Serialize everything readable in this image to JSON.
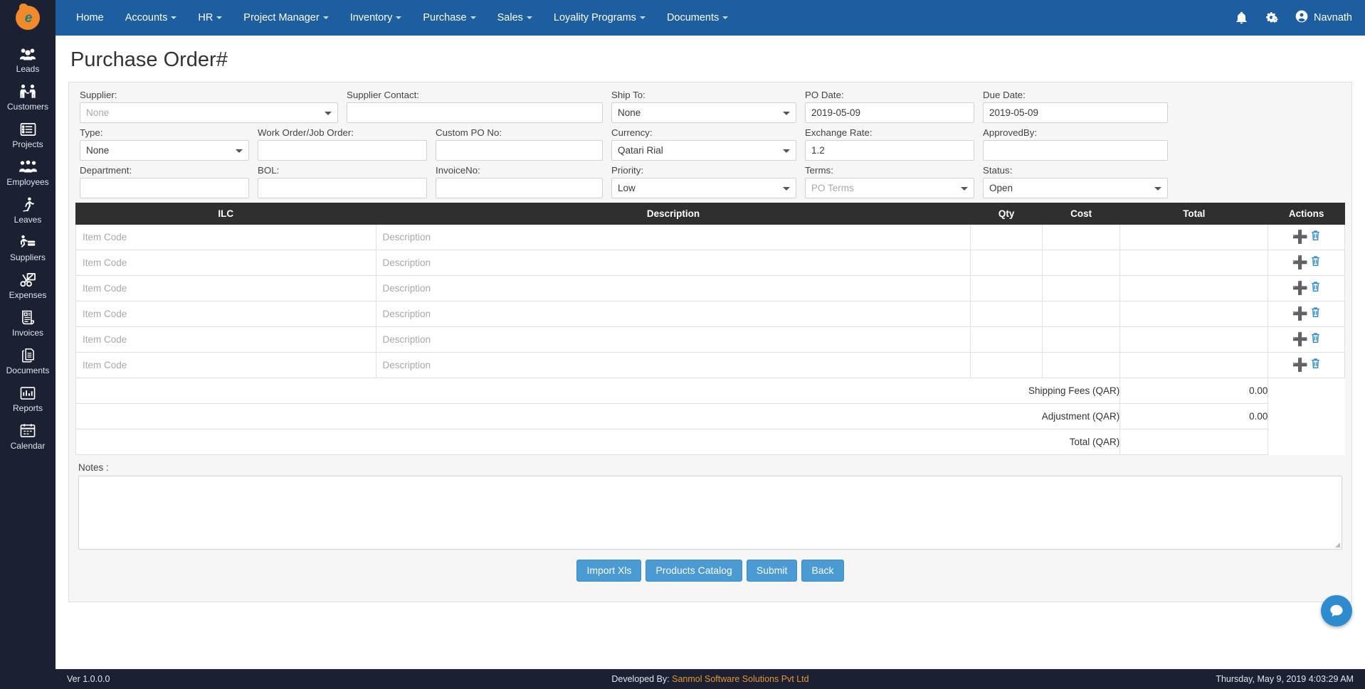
{
  "navbar": {
    "brand_icon": "brand-logo-icon",
    "menu": [
      {
        "label": "Home",
        "caret": false
      },
      {
        "label": "Accounts",
        "caret": true
      },
      {
        "label": "HR",
        "caret": true
      },
      {
        "label": "Project Manager",
        "caret": true
      },
      {
        "label": "Inventory",
        "caret": true
      },
      {
        "label": "Purchase",
        "caret": true
      },
      {
        "label": "Sales",
        "caret": true
      },
      {
        "label": "Loyality Programs",
        "caret": true
      },
      {
        "label": "Documents",
        "caret": true
      }
    ],
    "bell_icon": "bell-icon",
    "gear_icon": "gears-icon",
    "user_icon": "user-circle-icon",
    "user_name": "Navnath"
  },
  "sidebar": {
    "items": [
      {
        "label": "Leads",
        "icon": "leads-icon",
        "glyph": "⚇"
      },
      {
        "label": "Customers",
        "icon": "customers-icon",
        "glyph": "♟"
      },
      {
        "label": "Projects",
        "icon": "projects-icon",
        "glyph": "▤"
      },
      {
        "label": "Employees",
        "icon": "employees-icon",
        "glyph": "♟"
      },
      {
        "label": "Leaves",
        "icon": "leaves-icon",
        "glyph": "↯"
      },
      {
        "label": "Suppliers",
        "icon": "suppliers-icon",
        "glyph": "⛏"
      },
      {
        "label": "Expenses",
        "icon": "expenses-icon",
        "glyph": "✂"
      },
      {
        "label": "Invoices",
        "icon": "invoices-icon",
        "glyph": "▤"
      },
      {
        "label": "Documents",
        "icon": "documents-icon",
        "glyph": "⎘"
      },
      {
        "label": "Reports",
        "icon": "reports-icon",
        "glyph": "▦"
      },
      {
        "label": "Calendar",
        "icon": "calendar-icon",
        "glyph": "Ὄ5"
      }
    ]
  },
  "page": {
    "title": "Purchase Order#"
  },
  "form": {
    "supplier": {
      "label": "Supplier:",
      "value": "None",
      "is_placeholder": true
    },
    "supplier_contact": {
      "label": "Supplier Contact:",
      "value": ""
    },
    "ship_to": {
      "label": "Ship To:",
      "value": "None",
      "is_placeholder": false
    },
    "po_date": {
      "label": "PO Date:",
      "value": "2019-05-09"
    },
    "due_date": {
      "label": "Due Date:",
      "value": "2019-05-09"
    },
    "type": {
      "label": "Type:",
      "value": "None",
      "is_placeholder": false
    },
    "work_order": {
      "label": "Work Order/Job Order:",
      "value": ""
    },
    "custom_po_no": {
      "label": "Custom PO No:",
      "value": ""
    },
    "currency": {
      "label": "Currency:",
      "value": "Qatari Rial"
    },
    "exchange_rate": {
      "label": "Exchange Rate:",
      "value": "1.2"
    },
    "approved_by": {
      "label": "ApprovedBy:",
      "value": ""
    },
    "department": {
      "label": "Department:",
      "value": ""
    },
    "bol": {
      "label": "BOL:",
      "value": ""
    },
    "invoice_no": {
      "label": "InvoiceNo:",
      "value": ""
    },
    "priority": {
      "label": "Priority:",
      "value": "Low"
    },
    "terms": {
      "label": "Terms:",
      "value": "PO Terms",
      "is_placeholder": true
    },
    "status": {
      "label": "Status:",
      "value": "Open"
    }
  },
  "items_table": {
    "columns": [
      "ILC",
      "Description",
      "Qty",
      "Cost",
      "Total",
      "Actions"
    ],
    "row_placeholders": {
      "ilc": "Item Code",
      "description": "Description",
      "qty": "",
      "cost": "",
      "total": ""
    },
    "row_count": 6,
    "action_icons": {
      "add": "plus-icon",
      "delete": "trash-icon"
    },
    "summary": [
      {
        "label": "Shipping Fees (QAR)",
        "value": "0.00"
      },
      {
        "label": "Adjustment (QAR)",
        "value": "0.00"
      },
      {
        "label": "Total (QAR)",
        "value": ""
      }
    ]
  },
  "notes": {
    "label": "Notes :",
    "value": ""
  },
  "buttons": [
    {
      "label": "Import Xls",
      "name": "import-xls-button"
    },
    {
      "label": "Products Catalog",
      "name": "products-catalog-button"
    },
    {
      "label": "Submit",
      "name": "submit-button"
    },
    {
      "label": "Back",
      "name": "back-button"
    }
  ],
  "chat": {
    "icon": "chat-bubble-icon"
  },
  "footer": {
    "version": "Ver 1.0.0.0",
    "developed_by_prefix": "Developed By: ",
    "developed_by": "Sanmol Software Solutions Pvt Ltd",
    "datetime": "Thursday, May 9, 2019 4:03:29 AM"
  },
  "colors": {
    "navbar": "#1c5ea0",
    "sidebar": "#1b2133",
    "table_header": "#2f2f2f",
    "button": "#4a9ad4",
    "accent_link": "#e8952f",
    "icon_blue": "#2e8bd0"
  }
}
